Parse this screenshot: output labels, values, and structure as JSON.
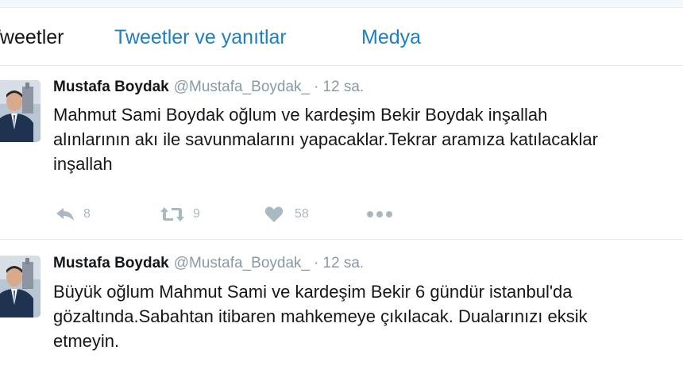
{
  "tabs": [
    {
      "label": "Tweetler"
    },
    {
      "label": "Tweetler ve yanıtlar"
    },
    {
      "label": "Medya"
    }
  ],
  "tweets": [
    {
      "name": "Mustafa Boydak",
      "handle": "@Mustafa_Boydak_",
      "separator": "·",
      "time": "12 sa.",
      "lines": [
        "Mahmut Sami Boydak oğlum ve kardeşim Bekir Boydak inşallah",
        "alınlarının akı ile savunmalarını yapacaklar.Tekrar aramıza katılacaklar",
        "inşallah"
      ],
      "replies": "8",
      "retweets": "9",
      "likes": "58"
    },
    {
      "name": "Mustafa Boydak",
      "handle": "@Mustafa_Boydak_",
      "separator": "·",
      "time": "12 sa.",
      "lines": [
        "Büyük oğlum Mahmut Sami ve kardeşim Bekir 6 gündür istanbul'da",
        "gözaltında.Sabahtan itibaren mahkemeye çıkılacak. Dualarınızı eksik",
        "etmeyin."
      ]
    }
  ],
  "colors": {
    "link_blue": "#1b7fc4",
    "text": "#14171a",
    "secondary": "#8899a6",
    "action_icon": "#aab8c2",
    "border": "#e6ecf0"
  },
  "icons": [
    "reply-icon",
    "retweet-icon",
    "heart-icon",
    "more-icon"
  ]
}
